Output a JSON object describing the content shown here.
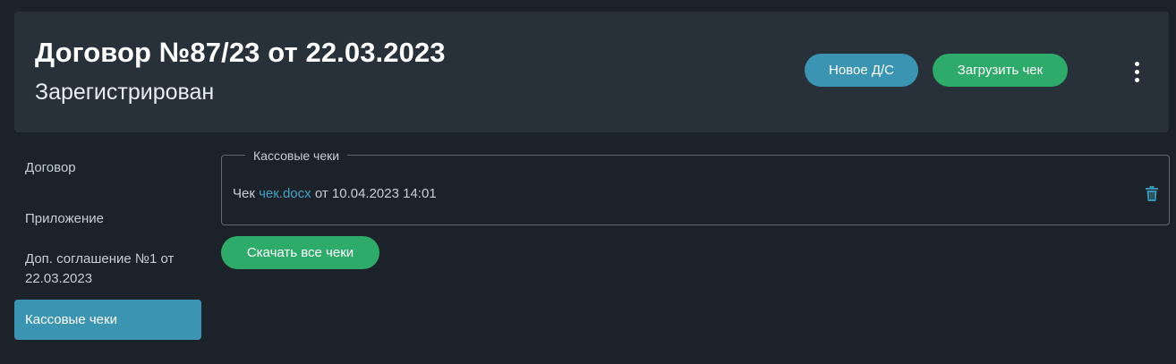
{
  "header": {
    "title": "Договор №87/23 от 22.03.2023",
    "status": "Зарегистрирован",
    "new_ds_label": "Новое Д/С",
    "upload_receipt_label": "Загрузить чек",
    "more_icon": "kebab-vertical-icon"
  },
  "sidebar": {
    "items": [
      {
        "label": "Договор",
        "active": false
      },
      {
        "label": "Приложение",
        "active": false
      },
      {
        "label": "Доп. соглашение №1 от 22.03.2023",
        "active": false
      },
      {
        "label": "Кассовые чеки",
        "active": true
      }
    ]
  },
  "receipts": {
    "legend": "Кассовые чеки",
    "items": [
      {
        "prefix": "Чек",
        "file_name": "чек.docx",
        "date_text": "от 10.04.2023 14:01",
        "delete_icon": "trash-icon"
      }
    ],
    "download_all_label": "Скачать все чеки"
  },
  "colors": {
    "background": "#1b2229",
    "card": "#28313a",
    "accent_blue": "#3b95b2",
    "accent_green": "#2eaa6a",
    "link": "#3fa2c4"
  }
}
